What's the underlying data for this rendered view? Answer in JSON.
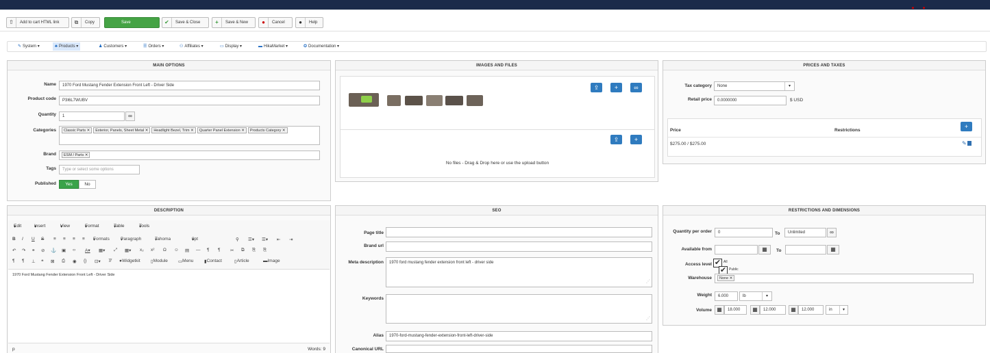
{
  "toolbar": {
    "add_to_cart": "Add to cart HTML link",
    "copy": "Copy",
    "save": "Save",
    "save_close": "Save & Close",
    "save_new": "Save & New",
    "cancel": "Cancel",
    "help": "Help"
  },
  "menu": {
    "system": "System",
    "products": "Products",
    "customers": "Customers",
    "orders": "Orders",
    "affiliates": "Affiliates",
    "display": "Display",
    "hikamarket": "HikaMarket",
    "documentation": "Documentation"
  },
  "main_options": {
    "title": "MAIN OPTIONS",
    "name_label": "Name",
    "name_value": "1970 Ford Mustang Fender Extension Front Left - Driver Side",
    "code_label": "Product code",
    "code_value": "P3I6L7WUBV",
    "quantity_label": "Quantity",
    "quantity_value": "1",
    "categories_label": "Categories",
    "categories": [
      "Classic Parts",
      "Exterior, Panels, Sheet Metal",
      "Headlight Bezel, Trim",
      "Quarter Panel Extension",
      "Products Category"
    ],
    "brand_label": "Brand",
    "brand_value": "ESM / Parts",
    "tags_label": "Tags",
    "tags_placeholder": "Type or select some options",
    "published_label": "Published",
    "yes": "Yes",
    "no": "No"
  },
  "images": {
    "title": "IMAGES AND FILES",
    "no_files": "No files - Drag & Drop here or use the upload button"
  },
  "prices": {
    "title": "PRICES AND TAXES",
    "tax_label": "Tax category",
    "tax_value": "None",
    "retail_label": "Retail price",
    "retail_value": "0.0000000",
    "currency": "$ USD",
    "col_price": "Price",
    "col_restrictions": "Restrictions",
    "price_row": "$275.00 / $275.00"
  },
  "description": {
    "title": "DESCRIPTION",
    "menu": [
      "Edit",
      "Insert",
      "View",
      "Format",
      "Table",
      "Tools"
    ],
    "formats": "Formats",
    "paragraph": "Paragraph",
    "font": "Tahoma",
    "size": "8pt",
    "widgetkit": "Widgetkit",
    "module": "Module",
    "menu_btn": "Menu",
    "contact": "Contact",
    "article": "Article",
    "image": "Image",
    "content": "1970 Ford Mustang Fender Extension Front Left - Driver Side",
    "path": "p",
    "words": "Words: 9"
  },
  "seo": {
    "title": "SEO",
    "page_title_label": "Page title",
    "brand_url_label": "Brand url",
    "meta_label": "Meta description",
    "meta_value": "1970 ford mustang fender extension front left - driver side",
    "keywords_label": "Keywords",
    "alias_label": "Alias",
    "alias_value": "1970-ford-mustang-fender-extension-front-left-driver-side",
    "canonical_label": "Canonical URL"
  },
  "restrictions": {
    "title": "RESTRICTIONS AND DIMENSIONS",
    "qpo_label": "Quantity per order",
    "qpo_from": "0",
    "to": "To",
    "qpo_to": "Unlimited",
    "avail_label": "Available from",
    "access_label": "Access level",
    "access_all": "All",
    "access_public": "Public",
    "warehouse_label": "Warehouse",
    "warehouse_value": "None",
    "weight_label": "Weight",
    "weight_value": "6.000",
    "weight_unit": "lb",
    "volume_label": "Volume",
    "vol1": "18.000",
    "vol2": "12.000",
    "vol3": "12.000",
    "vol_unit": "in"
  },
  "colors": {
    "header": "#1b2a4a",
    "save_green": "#45a345",
    "accent_blue": "#2f7bbf"
  }
}
